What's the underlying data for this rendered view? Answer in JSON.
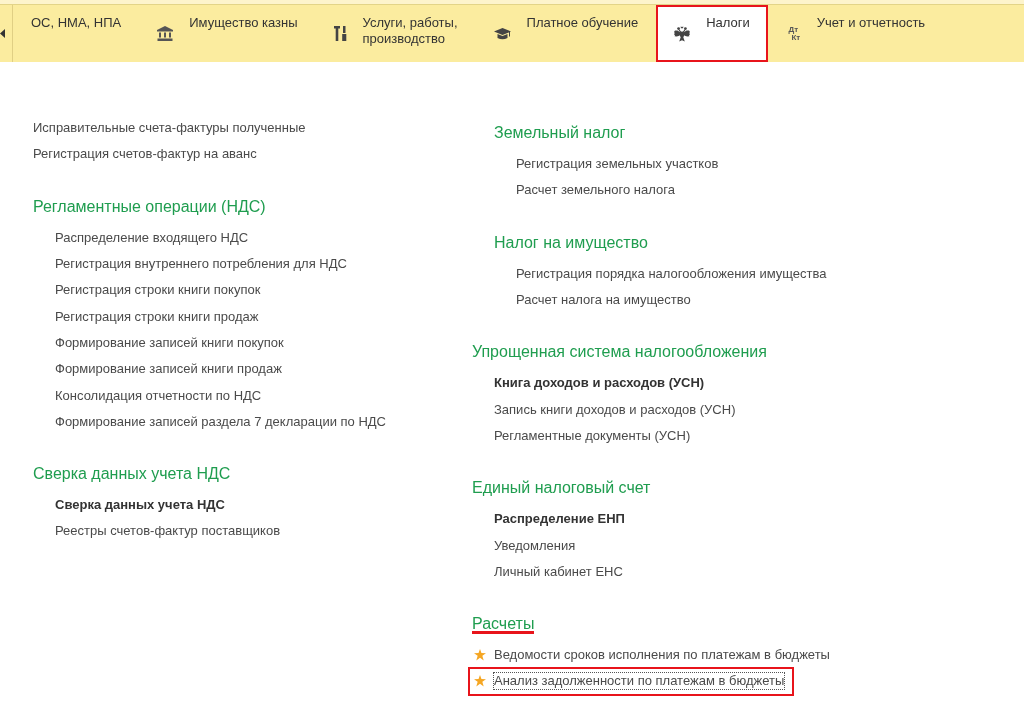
{
  "nav": {
    "tabs": [
      {
        "kind": "plain",
        "label": "ОС, НМА, НПА",
        "selected": false,
        "highlighted": false
      },
      {
        "kind": "property",
        "label": "Имущество казны",
        "selected": false,
        "highlighted": false
      },
      {
        "kind": "services",
        "label": "Услуги, работы,\nпроизводство",
        "selected": false,
        "highlighted": false
      },
      {
        "kind": "education",
        "label": "Платное обучение",
        "selected": false,
        "highlighted": false
      },
      {
        "kind": "taxes",
        "label": "Налоги",
        "selected": true,
        "highlighted": true
      },
      {
        "kind": "accounting",
        "label": "Учет и отчетность",
        "icon_text": [
          "Дт",
          "Кт"
        ],
        "selected": false,
        "highlighted": false
      }
    ]
  },
  "columns": [
    {
      "entries": [
        {
          "kind": "link",
          "label": "Исправительные счета-фактуры полученные",
          "bold": false
        },
        {
          "kind": "link",
          "label": "Регистрация счетов-фактур на аванс",
          "bold": false
        },
        {
          "kind": "group",
          "title": "Регламентные операции (НДС)",
          "highlighted": false,
          "children": [
            {
              "kind": "link",
              "label": "Распределение входящего НДС",
              "bold": false
            },
            {
              "kind": "link",
              "label": "Регистрация внутреннего потребления для НДС",
              "bold": false
            },
            {
              "kind": "link",
              "label": "Регистрация строки книги покупок",
              "bold": false
            },
            {
              "kind": "link",
              "label": "Регистрация строки книги продаж",
              "bold": false
            },
            {
              "kind": "link",
              "label": "Формирование записей книги покупок",
              "bold": false
            },
            {
              "kind": "link",
              "label": "Формирование записей книги продаж",
              "bold": false
            },
            {
              "kind": "link",
              "label": "Консолидация отчетности по НДС",
              "bold": false
            },
            {
              "kind": "link",
              "label": "Формирование записей раздела 7 декларации по НДС",
              "bold": false
            }
          ]
        },
        {
          "kind": "group",
          "title": "Сверка данных учета НДС",
          "highlighted": false,
          "children": [
            {
              "kind": "link",
              "label": "Сверка данных учета НДС",
              "bold": true
            },
            {
              "kind": "link",
              "label": "Реестры счетов-фактур поставщиков",
              "bold": false
            }
          ]
        }
      ]
    },
    {
      "entries": [
        {
          "kind": "group",
          "children": [
            {
              "kind": "group",
              "title": "Земельный налог",
              "highlighted": false,
              "children": [
                {
                  "kind": "link",
                  "label": "Регистрация земельных участков",
                  "bold": false
                },
                {
                  "kind": "link",
                  "label": "Расчет земельного налога",
                  "bold": false
                }
              ]
            },
            {
              "kind": "group",
              "title": "Налог на имущество",
              "highlighted": false,
              "children": [
                {
                  "kind": "link",
                  "label": "Регистрация порядка налогообложения имущества",
                  "bold": false
                },
                {
                  "kind": "link",
                  "label": "Расчет налога на имущество",
                  "bold": false
                }
              ]
            }
          ]
        },
        {
          "kind": "group",
          "title": "Упрощенная система налогообложения",
          "highlighted": false,
          "children": [
            {
              "kind": "link",
              "label": "Книга доходов и расходов (УСН)",
              "bold": true
            },
            {
              "kind": "link",
              "label": "Запись книги доходов и расходов (УСН)",
              "bold": false
            },
            {
              "kind": "link",
              "label": "Регламентные документы (УСН)",
              "bold": false
            }
          ]
        },
        {
          "kind": "group",
          "title": "Единый налоговый счет",
          "highlighted": false,
          "children": [
            {
              "kind": "link",
              "label": "Распределение ЕНП",
              "bold": true
            },
            {
              "kind": "link",
              "label": "Уведомления",
              "bold": false
            },
            {
              "kind": "link",
              "label": "Личный кабинет ЕНС",
              "bold": false
            }
          ]
        },
        {
          "kind": "group",
          "title": "Расчеты",
          "highlighted": true,
          "children": [
            {
              "kind": "link",
              "label": "Ведомости сроков исполнения по платежам в бюджеты",
              "bold": false,
              "starred": true,
              "highlighted": false,
              "focused": false
            },
            {
              "kind": "link",
              "label": "Анализ задолженности по платежам в бюджеты",
              "bold": false,
              "starred": true,
              "highlighted": true,
              "focused": true
            }
          ]
        }
      ]
    }
  ]
}
